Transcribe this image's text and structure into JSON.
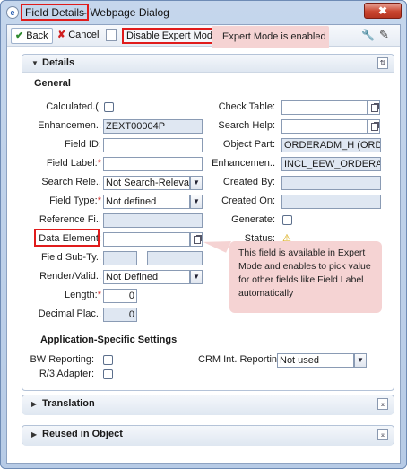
{
  "window": {
    "title_highlight": "Field Details",
    "title_rest": "-- Webpage Dialog",
    "app_icon": "e",
    "close_label": "✖"
  },
  "toolbar": {
    "back_label": "Back",
    "cancel_label": "Cancel",
    "disable_expert_label": "Disable Expert Mode",
    "back_icon": "check-icon",
    "cancel_icon": "cross-icon",
    "settings_icon": "wrench-icon",
    "edit_icon": "pencil-icon"
  },
  "callouts": {
    "expert_mode": "Expert Mode is enabled",
    "data_element": "This field is available in Expert Mode and enables to pick value for other fields like Field Label automatically"
  },
  "details": {
    "panel_title": "Details",
    "general_title": "General",
    "left": [
      {
        "label": "Calculated.(.",
        "type": "checkbox"
      },
      {
        "label": "Enhancemen..",
        "type": "input",
        "value": "ZEXT00004P",
        "readonly": true
      },
      {
        "label": "Field ID:",
        "type": "input",
        "value": ""
      },
      {
        "label": "Field Label:",
        "required": true,
        "type": "input",
        "value": ""
      },
      {
        "label": "Search Rele..",
        "type": "select",
        "value": "Not Search-Relevant"
      },
      {
        "label": "Field Type:",
        "required": true,
        "type": "select",
        "value": "Not defined"
      },
      {
        "label": "Reference Fi..",
        "type": "input",
        "value": "",
        "readonly": true
      },
      {
        "label": "Data Element:",
        "type": "input-help",
        "value": ""
      },
      {
        "label": "Field Sub-Ty..",
        "type": "double-input",
        "value": ""
      },
      {
        "label": "Render/Valid..",
        "type": "select",
        "value": "Not Defined"
      },
      {
        "label": "Length:",
        "required": true,
        "type": "number",
        "value": "0"
      },
      {
        "label": "Decimal Plac..",
        "type": "number",
        "value": "0",
        "readonly": true
      }
    ],
    "right": [
      {
        "label": "Check Table:",
        "type": "input-help",
        "value": ""
      },
      {
        "label": "Search Help:",
        "type": "input-help",
        "value": ""
      },
      {
        "label": "Object Part:",
        "type": "input",
        "value": "ORDERADM_H (ORDERADI",
        "readonly": true
      },
      {
        "label": "Enhancemen..",
        "type": "input",
        "value": "INCL_EEW_ORDERADM_H",
        "readonly": true
      },
      {
        "label": "Created By:",
        "type": "input",
        "value": "",
        "readonly": true
      },
      {
        "label": "Created On:",
        "type": "input",
        "value": "",
        "readonly": true
      },
      {
        "label": "Generate:",
        "type": "checkbox"
      },
      {
        "label": "Status:",
        "type": "status",
        "icon": "warning-icon"
      }
    ],
    "app_settings_title": "Application-Specific Settings",
    "bw_reporting_label": "BW Reporting:",
    "r3_adapter_label": "R/3 Adapter:",
    "crm_label": "CRM Int. Reportin",
    "crm_value": "Not used"
  },
  "panels": {
    "translation_title": "Translation",
    "reused_title": "Reused in Object"
  },
  "colors": {
    "highlight_border": "#e01b1b",
    "callout_bg": "#f5d3d3",
    "readonly_bg": "#dfe7f2"
  }
}
